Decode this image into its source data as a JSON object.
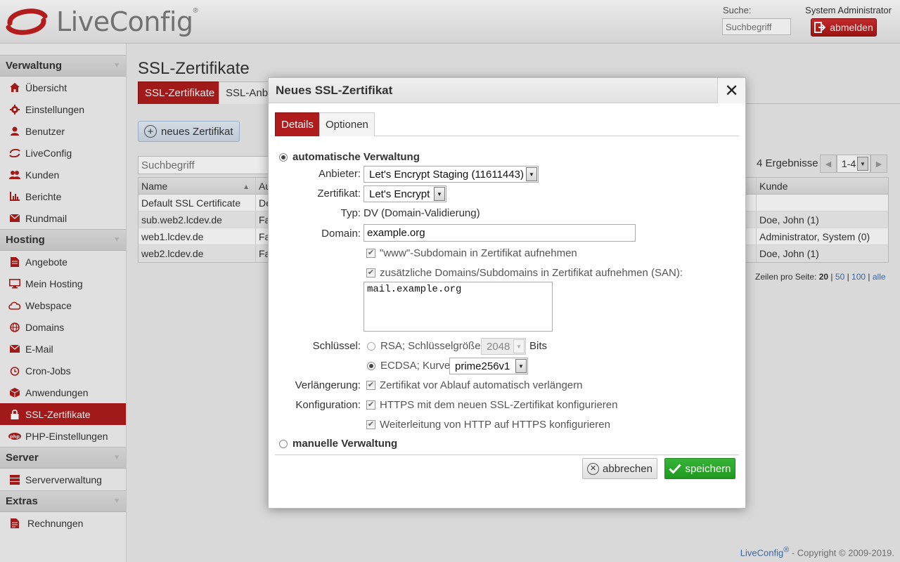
{
  "header": {
    "brand": "LiveConfig",
    "brand_reg": "®",
    "search_label": "Suche:",
    "search_placeholder": "Suchbegriff",
    "user": "System Administrator",
    "logout": "abmelden"
  },
  "sidebar": {
    "sections": [
      {
        "title": "Verwaltung",
        "items": [
          "Übersicht",
          "Einstellungen",
          "Benutzer",
          "LiveConfig",
          "Kunden",
          "Berichte",
          "Rundmail"
        ]
      },
      {
        "title": "Hosting",
        "items": [
          "Angebote",
          "Mein Hosting",
          "Webspace",
          "Domains",
          "E-Mail",
          "Cron-Jobs",
          "Anwendungen",
          "SSL-Zertifikate",
          "PHP-Einstellungen"
        ]
      },
      {
        "title": "Server",
        "items": [
          "Serververwaltung"
        ]
      },
      {
        "title": "Extras",
        "items": [
          "Rechnungen"
        ]
      }
    ]
  },
  "main": {
    "title": "SSL-Zertifikate",
    "tab_active": "SSL-Zertifikate",
    "tab_other": "SSL-Anbi",
    "new_button": "neues Zertifikat",
    "search_placeholder": "Suchbegriff",
    "results": "4 Ergebnisse",
    "pager_value": "1-4",
    "columns": {
      "name": "Name",
      "au": "Au",
      "kunde": "Kunde"
    },
    "rows": [
      {
        "name": "Default SSL Certificate",
        "au": "De",
        "kunde": ""
      },
      {
        "name": "sub.web2.lcdev.de",
        "au": "Fa",
        "kunde": "Doe, John (1)"
      },
      {
        "name": "web1.lcdev.de",
        "au": "Fa",
        "kunde": "Administrator, System (0)"
      },
      {
        "name": "web2.lcdev.de",
        "au": "Fa",
        "kunde": "Doe, John (1)"
      }
    ],
    "rows_per_page_label": "Zeilen pro Seite:",
    "rows_per_page": {
      "current": "20",
      "opt1": "50",
      "opt2": "100",
      "opt3": "alle"
    },
    "sep1": " | ",
    "sep2": " | ",
    "sep3": " | "
  },
  "footer": {
    "brand": "LiveConfig",
    "reg": "®",
    "copyright": " - Copyright © 2009-2019."
  },
  "dialog": {
    "title": "Neues SSL-Zertifikat",
    "tabs": {
      "details": "Details",
      "optionen": "Optionen"
    },
    "auto_label": "automatische Verwaltung",
    "anbieter_label": "Anbieter:",
    "anbieter_value": "Let's Encrypt Staging (11611443)",
    "zertifikat_label": "Zertifikat:",
    "zertifikat_value": "Let's Encrypt",
    "typ_label": "Typ:",
    "typ_value": "DV (Domain-Validierung)",
    "domain_label": "Domain:",
    "domain_value": "example.org",
    "www_label": "\"www\"-Subdomain in Zertifikat aufnehmen",
    "san_label": "zusätzliche Domains/Subdomains in Zertifikat aufnehmen (SAN):",
    "san_value": "mail.example.org",
    "schluessel_label": "Schlüssel:",
    "rsa_label": "RSA; Schlüsselgröße:",
    "rsa_size": "2048",
    "bits": "Bits",
    "ecdsa_label": "ECDSA; Kurve:",
    "ecdsa_curve": "prime256v1",
    "verl_label": "Verlängerung:",
    "verl_text": "Zertifikat vor Ablauf automatisch verlängern",
    "konf_label": "Konfiguration:",
    "konf_text1": "HTTPS mit dem neuen SSL-Zertifikat konfigurieren",
    "konf_text2": "Weiterleitung von HTTP auf HTTPS konfigurieren",
    "manual_label": "manuelle Verwaltung",
    "cancel": "abbrechen",
    "save": "speichern"
  },
  "colors": {
    "accent_red": "#b01c1c",
    "save_green": "#29a629",
    "link_blue": "#3d6fb2"
  }
}
